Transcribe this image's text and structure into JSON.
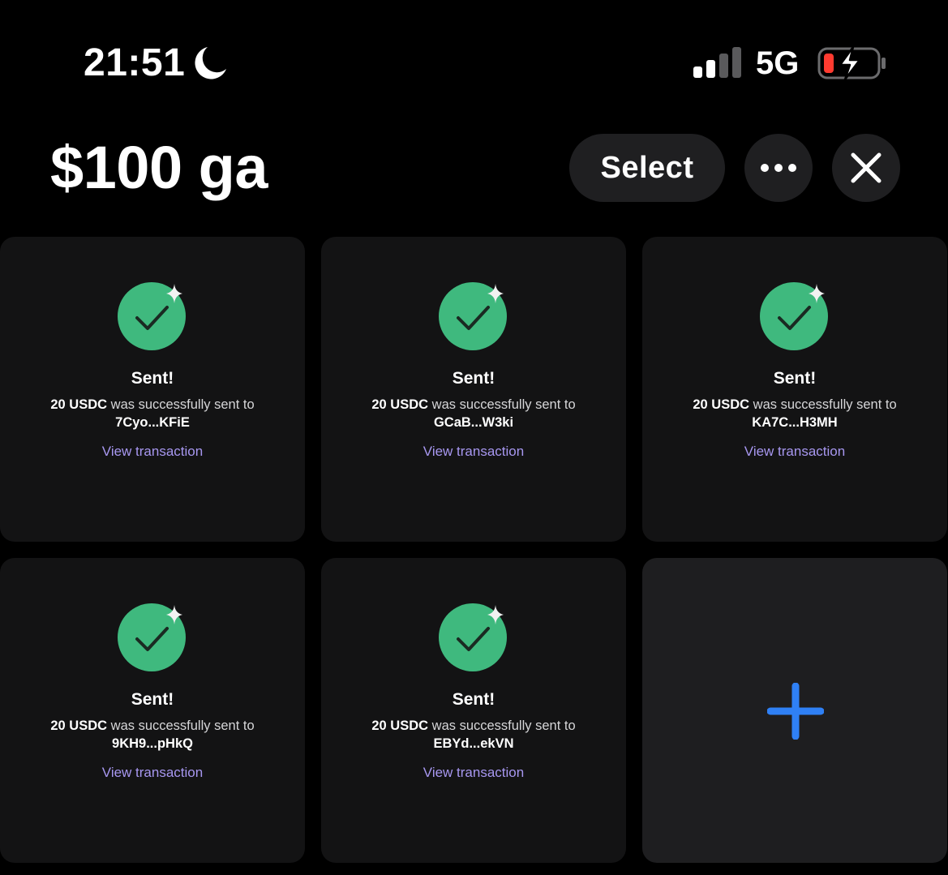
{
  "status_bar": {
    "time": "21:51",
    "network": "5G"
  },
  "header": {
    "title": "$100 ga",
    "select_label": "Select"
  },
  "icons": {
    "moon": "moon-icon",
    "signal": "cellular-signal-icon",
    "battery": "battery-charging-icon",
    "more": "ellipsis-icon",
    "close": "close-icon",
    "check": "check-circle-icon",
    "add": "plus-icon"
  },
  "colors": {
    "background": "#000000",
    "card": "#131314",
    "success_green": "#3fb97e",
    "link": "#a797f0",
    "plus_blue": "#2f80f5",
    "battery_low": "#ff3b30"
  },
  "cards": [
    {
      "title": "Sent!",
      "amount": "20 USDC",
      "message": " was successfully sent to",
      "address": "7Cyo...KFiE",
      "link": "View transaction"
    },
    {
      "title": "Sent!",
      "amount": "20 USDC",
      "message": " was successfully sent to",
      "address": "GCaB...W3ki",
      "link": "View transaction"
    },
    {
      "title": "Sent!",
      "amount": "20 USDC",
      "message": " was successfully sent to",
      "address": "KA7C...H3MH",
      "link": "View transaction"
    },
    {
      "title": "Sent!",
      "amount": "20 USDC",
      "message": " was successfully sent to",
      "address": "9KH9...pHkQ",
      "link": "View transaction"
    },
    {
      "title": "Sent!",
      "amount": "20 USDC",
      "message": " was successfully sent to",
      "address": "EBYd...ekVN",
      "link": "View transaction"
    }
  ]
}
